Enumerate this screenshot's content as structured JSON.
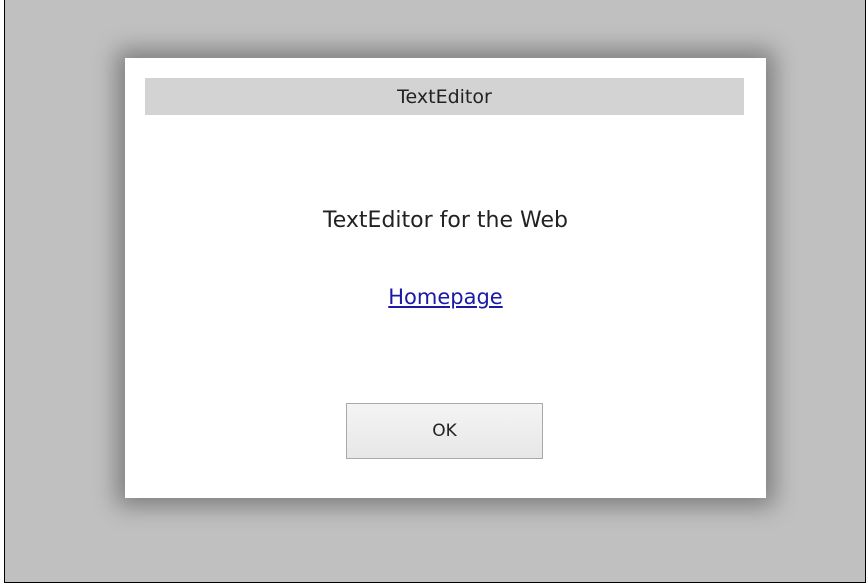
{
  "dialog": {
    "title": "TextEditor",
    "message": "TextEditor for the Web",
    "link_label": "Homepage",
    "ok_label": "OK"
  },
  "colors": {
    "backdrop": "#c0c0c0",
    "dialog_background": "#ffffff",
    "titlebar": "#d3d3d3",
    "link": "#1a1aa6"
  }
}
